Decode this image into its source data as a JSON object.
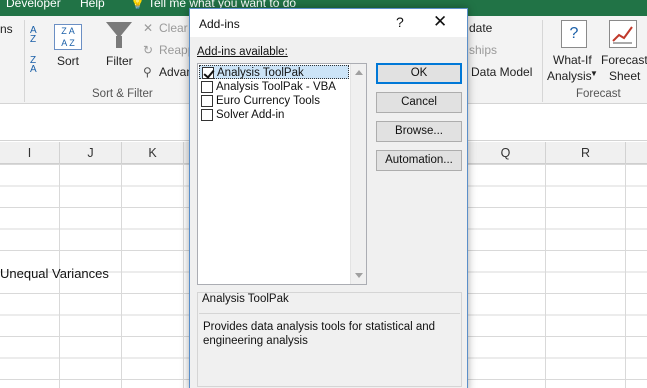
{
  "titlebar": {
    "tab_developer": "Developer",
    "tab_help": "Help",
    "tell_me": "Tell me what you want to do"
  },
  "ribbon": {
    "ns_label": "ns",
    "sort_label": "Sort",
    "filter_label": "Filter",
    "clear_label": "Clear",
    "reapply_label": "Reapply",
    "advanced_label": "Advanced",
    "sort_filter_group": "Sort & Filter",
    "update_label": "date",
    "relationships_label": "ships",
    "data_model_label": "Data Model",
    "whatif_line1": "What-If",
    "whatif_line2": "Analysis",
    "forecast_line1": "Forecast",
    "forecast_line2": "Sheet",
    "forecast_group": "Forecast"
  },
  "columns": [
    "I",
    "J",
    "K",
    "Q",
    "R"
  ],
  "cell_text": "Unequal Variances",
  "dialog": {
    "title": "Add-ins",
    "help": "?",
    "close": "✕",
    "available_label": "Add-ins available:",
    "items": [
      {
        "label": "Analysis ToolPak",
        "checked": true
      },
      {
        "label": "Analysis ToolPak - VBA",
        "checked": false
      },
      {
        "label": "Euro Currency Tools",
        "checked": false
      },
      {
        "label": "Solver Add-in",
        "checked": false
      }
    ],
    "ok": "OK",
    "cancel": "Cancel",
    "browse": "Browse...",
    "automation": "Automation...",
    "description_title": "Analysis ToolPak",
    "description_body": "Provides data analysis tools for statistical and engineering analysis"
  },
  "colors": {
    "excel_green": "#217346",
    "accent": "#0078d7",
    "selection": "#cce4f7"
  }
}
